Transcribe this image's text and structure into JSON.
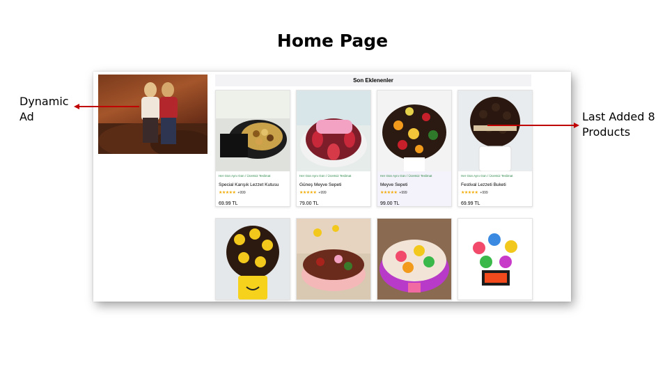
{
  "slide": {
    "title": "Home Page",
    "callout_left": "Dynamic Ad",
    "callout_right": "Last Added 8 Products"
  },
  "colors": {
    "arrow": "#c00000",
    "shipping_text": "#2e8a4a",
    "star": "#f2a900",
    "highlight_card": "#f4f2fa"
  },
  "section": {
    "title": "Son Eklenenler"
  },
  "products": [
    {
      "shipping": "Her Gün Aynı Gün / Ücretsiz Teslimat",
      "name": "Special Karışık Lezzet Kutusu",
      "stars": "★★★★★",
      "count": "+999",
      "price": "69.99 TL"
    },
    {
      "shipping": "Her Gün Aynı Gün / Ücretsiz Teslimat",
      "name": "Güneş Meyve Sepeti",
      "stars": "★★★★★",
      "count": "+999",
      "price": "79.00 TL"
    },
    {
      "shipping": "Her Gün Aynı Gün / Ücretsiz Teslimat",
      "name": "Meyve Sepeti",
      "stars": "★★★★★",
      "count": "+999",
      "price": "99.00 TL"
    },
    {
      "shipping": "Her Gün Aynı Gün / Ücretsiz Teslimat",
      "name": "Festival Lezzeti Buketi",
      "stars": "★★★★★",
      "count": "+999",
      "price": "69.99 TL"
    }
  ]
}
